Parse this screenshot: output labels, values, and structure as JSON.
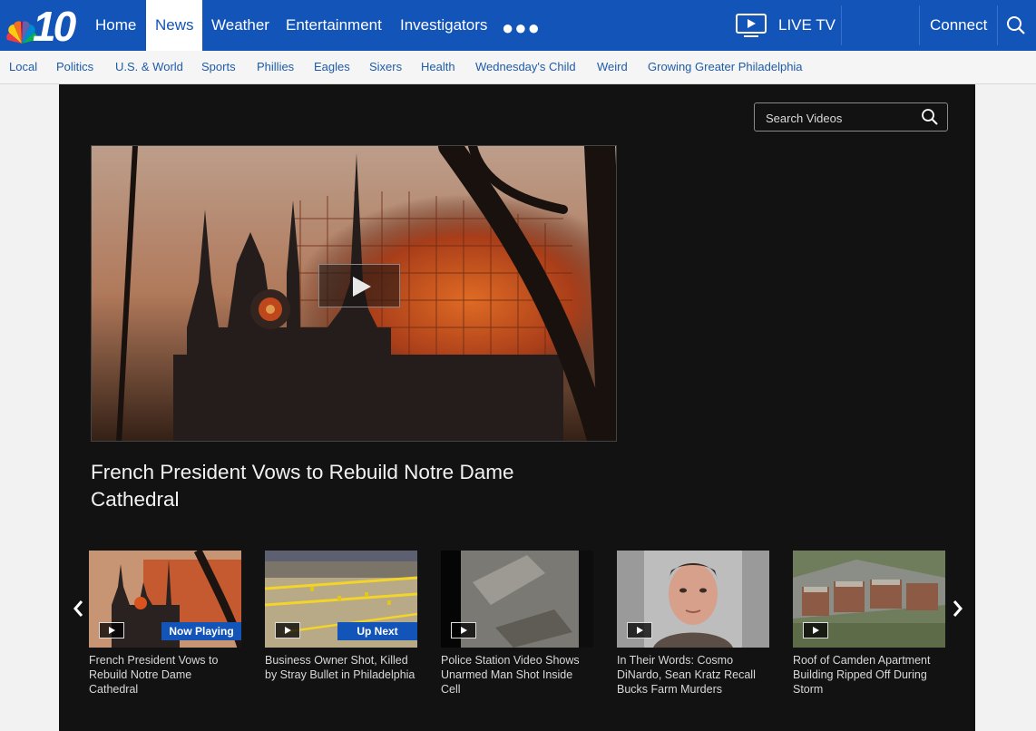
{
  "header": {
    "logo_number": "10",
    "nav": [
      "Home",
      "News",
      "Weather",
      "Entertainment",
      "Investigators"
    ],
    "active_nav": "News",
    "live_tv_label": "LIVE TV",
    "connect_label": "Connect"
  },
  "subnav": [
    "Local",
    "Politics",
    "U.S. & World",
    "Sports",
    "Phillies",
    "Eagles",
    "Sixers",
    "Health",
    "Wednesday's Child",
    "Weird",
    "Growing Greater Philadelphia"
  ],
  "search": {
    "placeholder": "Search Videos"
  },
  "player": {
    "title": "French President Vows to Rebuild Notre Dame Cathedral"
  },
  "playlist": [
    {
      "caption": "French President Vows to Rebuild Notre Dame Cathedral",
      "badge": "Now Playing"
    },
    {
      "caption": "Business Owner Shot, Killed by Stray Bullet in Philadelphia",
      "badge": "Up Next"
    },
    {
      "caption": "Police Station Video Shows Unarmed Man Shot Inside Cell",
      "badge": ""
    },
    {
      "caption": "In Their Words: Cosmo DiNardo, Sean Kratz Recall Bucks Farm Murders",
      "badge": ""
    },
    {
      "caption": "Roof of Camden Apartment Building Ripped Off During Storm",
      "badge": ""
    }
  ],
  "colors": {
    "brand_blue": "#1354b8",
    "player_bg": "#121212"
  }
}
